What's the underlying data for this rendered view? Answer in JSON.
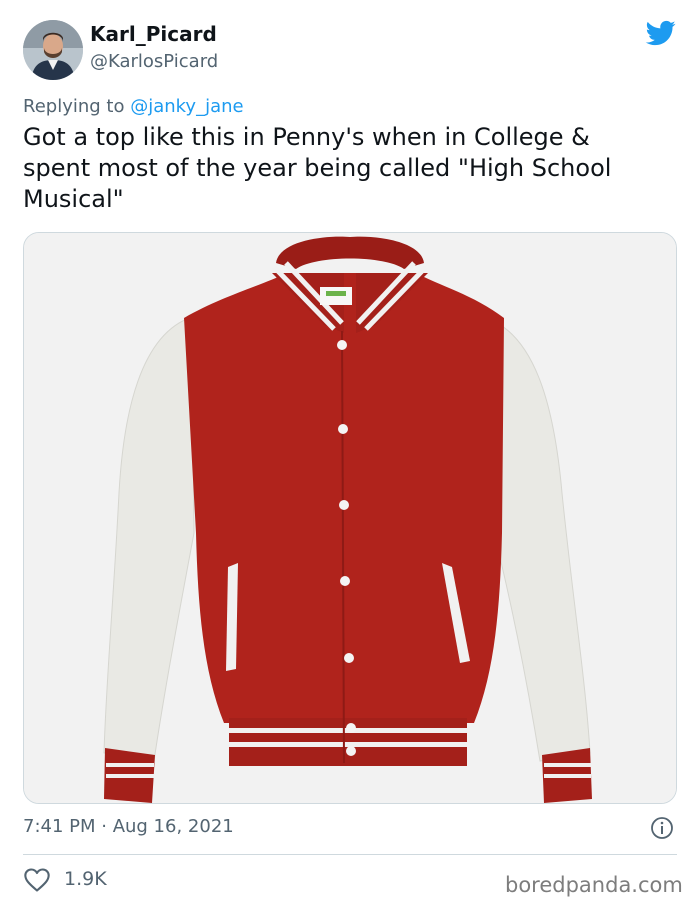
{
  "author": {
    "display_name": "Karl_Picard",
    "handle": "@KarlosPicard",
    "avatar_icon": "profile-photo"
  },
  "reply": {
    "prefix": "Replying to ",
    "mention": "@janky_jane"
  },
  "tweet": {
    "text": "Got a top like this in Penny's when in College &\nspent most of the year being called \"High School\nMusical\"",
    "timestamp": "7:41 PM · Aug 16, 2021"
  },
  "media": {
    "description_icon": "varsity-jacket-photo",
    "jacket_body_color": "#b0231c",
    "sleeve_color": "#e9e9e4"
  },
  "engagement": {
    "likes": "1.9K",
    "like_icon": "heart-outline-icon"
  },
  "watermark": "boredpanda.com",
  "colors": {
    "twitter_blue": "#1d9bf0",
    "secondary_text": "#536471"
  }
}
